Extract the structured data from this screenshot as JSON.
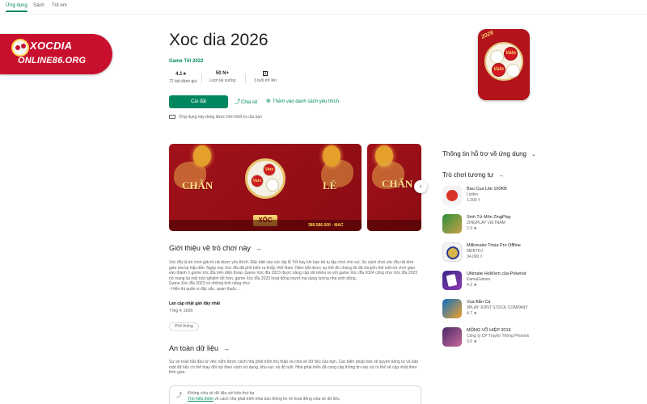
{
  "nav": {
    "tabs": [
      {
        "label": "Ứng dụng",
        "active": true
      },
      {
        "label": "Sách",
        "active": false
      },
      {
        "label": "Trẻ em",
        "active": false
      }
    ]
  },
  "watermark": {
    "line1": "XOCDIA",
    "line2": "ONLINE86.ORG"
  },
  "app": {
    "title": "Xoc dia 2026",
    "developer": "Game Tết 2022",
    "stats": [
      {
        "value": "4.1★",
        "label": "72 bài đánh giá"
      },
      {
        "value": "50 N+",
        "label": "Lượt tải xuống"
      },
      {
        "value": "3",
        "label": "3 tuổi trở lên"
      }
    ],
    "install_label": "Cài đặt",
    "share_label": "Chia sẻ",
    "wishlist_label": "Thêm vào danh sách yêu thích",
    "device_note": "Ứng dụng này dùng được trên thiết bị của bạn",
    "icon_year": "2026",
    "icon_coin_text": "Vato"
  },
  "screenshots": {
    "shot1": {
      "left_label": "CHẴN",
      "right_label": "LẺ",
      "xoc_label": "XÓC",
      "coin_text": "Vato",
      "score": "389.586.000 · MAC"
    },
    "shot2": {
      "left_label": "CHẴN"
    }
  },
  "about": {
    "title": "Giới thiệu về trò chơi này",
    "arrow": "→",
    "text": "Xóc đĩa là trò chơi giải trí rất được yêu thích. Đặc biệt vào các dịp lễ Tết hay khi bạn bè tụ tập chơi cho vui. So cách chơi xóc đĩa rất đơn giản mà lại hấp dẫn. Ngày nay Xóc đĩa đã phổ biến ra khắp Việt Nam. Năm bắt được sự thể đó chúng tôi đã chuyển thể một trò chơi gian vào thành 1 game xóc đĩa trên điện thoại. Game Xóc đĩa 2023 được nâng cấp rất nhiều so với game Xóc đĩa 2024 cũng như Xóc đĩa 2023 nó mang lại một trải nghiệm tốt hơn, game Xóc đĩa 2023 hoạt động mượt mà dung lượng nhẹ sinh động.",
    "text2": "Game Xóc đĩa 2023 có những tính năng như:",
    "text3": "- Hiển thị quân vị đặc sắc, quan thuộc...",
    "updated_label": "Lần cập nhật gần đây nhất",
    "updated_value": "7 thg 4, 2026",
    "chip": "Phổ thông"
  },
  "safety": {
    "title": "An toàn dữ liệu",
    "arrow": "→",
    "text": "Sự an toàn bắt đầu từ việc nắm được cách nhà phát triển thu thập và chia sẻ dữ liệu của bạn. Các biện pháp bảo vệ quyền riêng tư và bảo mật dữ liệu có thể thay đổi tuỳ theo cách sử dụng, khu vực và độ tuổi. Nhà phát triển đã cung cấp thông tin này và có thể sẽ cập nhật theo thời gian.",
    "row1": "Không chia sẻ dữ liệu với bên thứ ba",
    "row2_link": "Tìm hiểu thêm",
    "row2": " về cách nhà phát triển khai báo thông tin về hoạt động chia sẻ dữ liệu"
  },
  "sidebar": {
    "support_title": "Thông tin hỗ trợ về ứng dụng",
    "similar_title": "Trò chơi tương tự",
    "similar_arrow": "→",
    "items": [
      {
        "name": "Bau Cua Lite 100KB",
        "dev": "Lizdev",
        "rating": "1.300 ₫"
      },
      {
        "name": "Sinh Tử Môn ZingPlay",
        "dev": "ZINGPLAY VIETNAM",
        "rating": "2.9 ★"
      },
      {
        "name": "Millionaire Trivia Pro Offline",
        "dev": "MEBTDJ",
        "rating": "34.000 ₫"
      },
      {
        "name": "Ultimate Hold'em của Pokerist",
        "dev": "KamaGames",
        "rating": "4.3 ★"
      },
      {
        "name": "Vua Bắn Cá",
        "dev": "9PLAY JOINT STOCK COMPANY",
        "rating": "4.7 ★"
      },
      {
        "name": "MỘNG VÕ HIỆP 2019",
        "dev": "Công ty CP Truyền Thông Phoenix",
        "rating": "3.6 ★"
      }
    ]
  }
}
